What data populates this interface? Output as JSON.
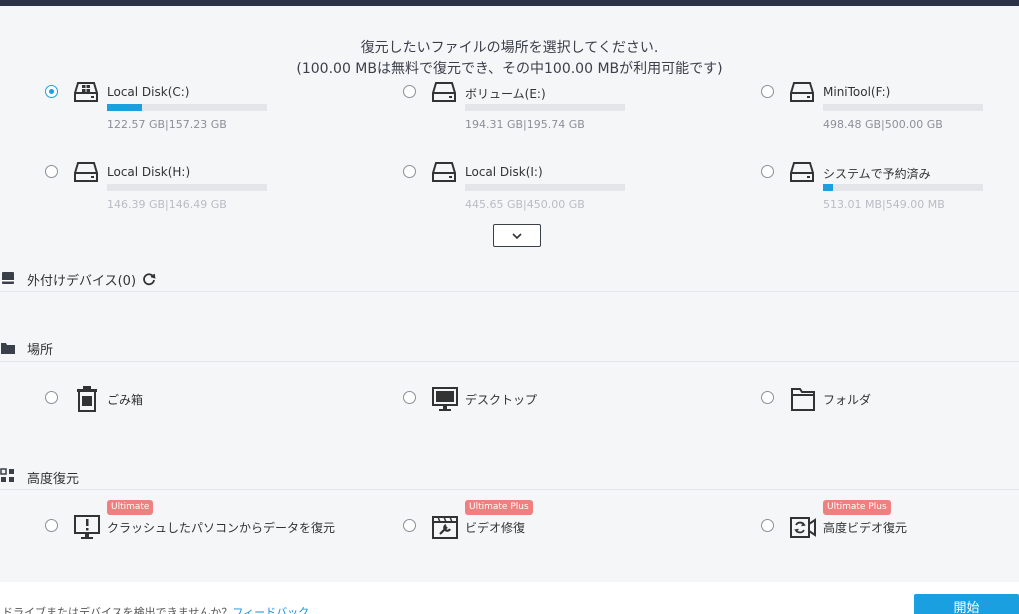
{
  "header": {
    "line1": "復元したいファイルの場所を選択してください.",
    "line2": "(100.00 MBは無料で復元でき、その中100.00 MBが利用可能です)"
  },
  "disks": [
    {
      "name": "Local Disk(C:)",
      "size": "122.57 GB|157.23 GB",
      "used_fraction": 0.22,
      "selected": true
    },
    {
      "name": "ボリューム(E:)",
      "size": "194.31 GB|195.74 GB",
      "used_fraction": 0.0,
      "selected": false
    },
    {
      "name": "MiniTool(F:)",
      "size": "498.48 GB|500.00 GB",
      "used_fraction": 0.0,
      "selected": false
    },
    {
      "name": "Local Disk(H:)",
      "size": "146.39 GB|146.49 GB",
      "used_fraction": 0.0,
      "selected": false
    },
    {
      "name": "Local Disk(I:)",
      "size": "445.65 GB|450.00 GB",
      "used_fraction": 0.0,
      "selected": false
    },
    {
      "name": "システムで予約済み",
      "size": "513.01 MB|549.00 MB",
      "used_fraction": 0.06,
      "selected": false
    }
  ],
  "external": {
    "title": "外付けデバイス(0)"
  },
  "locations": {
    "title": "場所",
    "items": [
      {
        "label": "ごみ箱",
        "icon": "trash-icon"
      },
      {
        "label": "デスクトップ",
        "icon": "desktop-icon"
      },
      {
        "label": "フォルダ",
        "icon": "folder-icon"
      }
    ]
  },
  "advanced": {
    "title": "高度復元",
    "items": [
      {
        "label": "クラッシュしたパソコンからデータを復元",
        "badge": "Ultimate",
        "icon": "crashed-pc-icon"
      },
      {
        "label": "ビデオ修復",
        "badge": "Ultimate Plus",
        "icon": "video-repair-icon"
      },
      {
        "label": "高度ビデオ復元",
        "badge": "Ultimate Plus",
        "icon": "video-recovery-icon"
      }
    ]
  },
  "footer": {
    "question": "ドライブまたはデバイスを検出できませんか？",
    "link": "フィードバック",
    "start": "開始"
  },
  "colors": {
    "accent": "#1aa0e0",
    "badge": "#f07f7f",
    "topbar": "#2b3447"
  }
}
